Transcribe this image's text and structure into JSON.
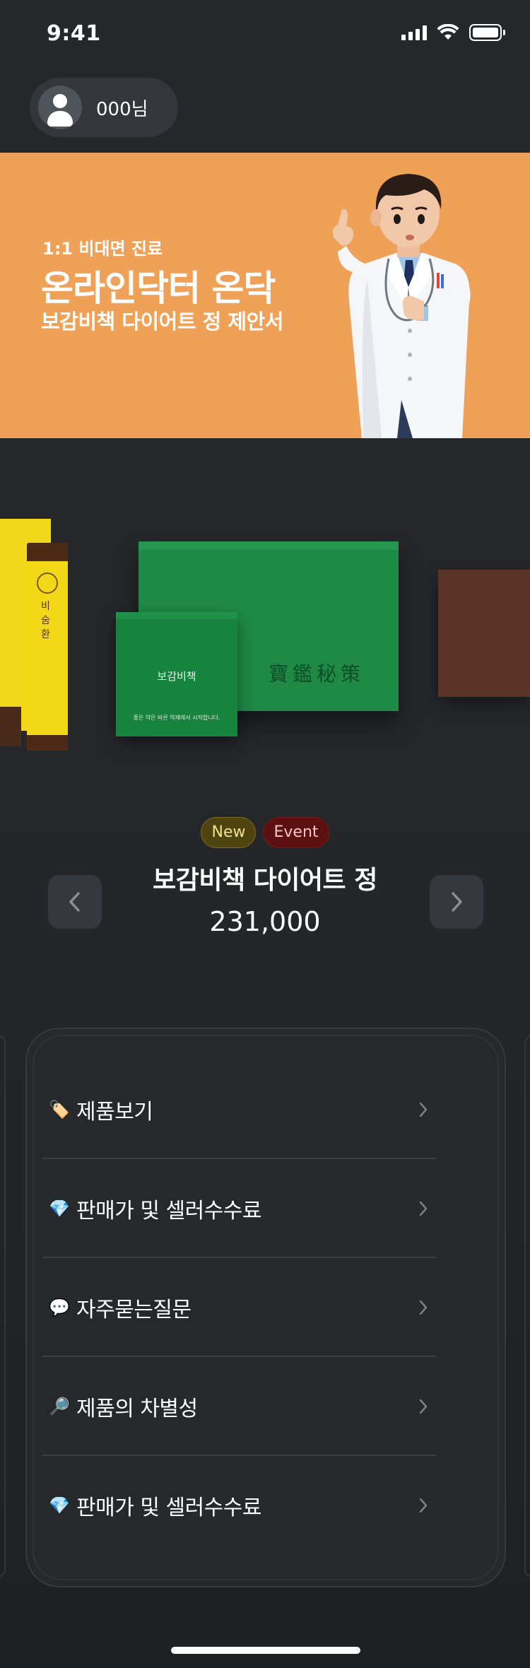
{
  "status_bar": {
    "time": "9:41",
    "icons": [
      "signal-icon",
      "wifi-icon",
      "battery-icon"
    ]
  },
  "user": {
    "name": "000님",
    "avatar_icon": "user-avatar-icon"
  },
  "banner": {
    "subtitle": "1:1 비대면 진료",
    "title": "온라인닥터 온닥",
    "description": "보감비책 다이어트 정 제안서",
    "background_color": "#f0a158"
  },
  "carousel": {
    "pouch_title": "보감비책",
    "pouch_line": "좋은 약은 바른 약재에서 시작합니다.",
    "stick_text": "비숨환",
    "box_text": "寶鑑秘策"
  },
  "product": {
    "badges": [
      "New",
      "Event"
    ],
    "name": "보감비책 다이어트 정",
    "price": "231,000",
    "prev_icon": "chevron-left-icon",
    "next_icon": "chevron-right-icon"
  },
  "menu": {
    "items": [
      {
        "emoji": "🏷️",
        "label": "제품보기"
      },
      {
        "emoji": "💎",
        "label": "판매가 및 셀러수수료"
      },
      {
        "emoji": "💬",
        "label": "자주묻는질문"
      },
      {
        "emoji": "🔎",
        "label": "제품의 차별성"
      },
      {
        "emoji": "💎",
        "label": "판매가 및 셀러수수료"
      }
    ]
  },
  "colors": {
    "background": "#25272b",
    "card": "#26282c",
    "badge_new": "#4f4410",
    "badge_event": "#5c1010"
  }
}
